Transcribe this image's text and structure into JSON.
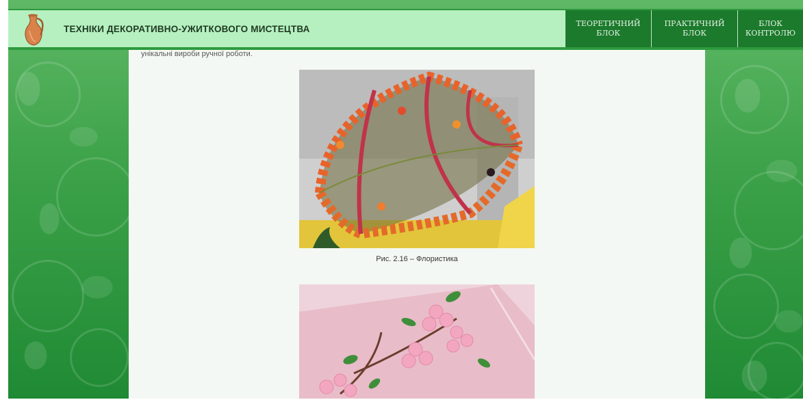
{
  "header": {
    "site_title": "ТЕХНІКИ ДЕКОРАТИВНО-УЖИТКОВОГО МИСТЕЦТВА",
    "logo_icon": "jug-icon",
    "nav": [
      {
        "label": "ТЕОРЕТИЧНИЙ БЛОК"
      },
      {
        "label": "ПРАКТИЧНИЙ БЛОК"
      },
      {
        "label": "БЛОК КОНТРОЛЮ"
      }
    ]
  },
  "content": {
    "intro_text": "унікальні вироби ручної роботи.",
    "figures": [
      {
        "caption": "Рис. 2.16 – Флористика",
        "image": "floral-umbrella-photo"
      },
      {
        "caption": "",
        "image": "quilling-flowers-photo"
      }
    ]
  },
  "colors": {
    "header_bg": "#b6f0c0",
    "nav_bg": "#1c7a2c",
    "page_bg": "#3ea34a"
  }
}
